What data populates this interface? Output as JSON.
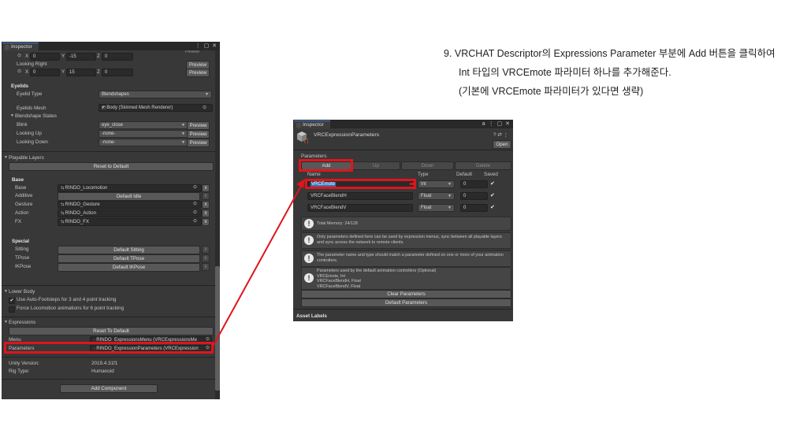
{
  "left": {
    "tab": "Inspector",
    "window_controls": "⋮ ▢ ✕",
    "top_cut_label": "Preview",
    "rows": {
      "eye_left": {
        "x_label": "X",
        "x_value": "0",
        "y_label": "Y",
        "y_value": "-15",
        "z_label": "Z",
        "z_value": "0",
        "preview": "Preview"
      },
      "looking_right": "Looking Right",
      "eye_right": {
        "x_label": "X",
        "x_value": "0",
        "y_label": "Y",
        "y_value": "15",
        "z_label": "Z",
        "z_value": "0",
        "preview": "Preview"
      }
    },
    "eyelids": {
      "title": "Eyelids",
      "type_label": "Eyelid Type",
      "type_value": "Blendshapes",
      "mesh_label": "Eyelids Mesh",
      "mesh_value": "Body (Skinned Mesh Renderer)",
      "states_label": "Blendshape States",
      "states": [
        {
          "label": "Blink",
          "value": "eye_close",
          "preview": "Preview"
        },
        {
          "label": "Looking Up",
          "value": "-none-",
          "preview": "Preview"
        },
        {
          "label": "Looking Down",
          "value": "-none-",
          "preview": "Preview"
        }
      ]
    },
    "playable": {
      "title": "Playable Layers",
      "reset": "Reset to Default",
      "base_title": "Base",
      "base": [
        {
          "label": "Base",
          "value": "RINDO_Locomotion",
          "x": "x"
        },
        {
          "label": "Additive",
          "value": "Default Idle",
          "x": "x"
        },
        {
          "label": "Gesture",
          "value": "RINDO_Gesture",
          "x": "x"
        },
        {
          "label": "Action",
          "value": "RINDO_Action",
          "x": "x"
        },
        {
          "label": "FX",
          "value": "RINDO_FX",
          "x": "x"
        }
      ],
      "special_title": "Special",
      "special": [
        {
          "label": "Sitting",
          "value": "Default Sitting",
          "x": "x"
        },
        {
          "label": "TPose",
          "value": "Default TPose",
          "x": "x"
        },
        {
          "label": "IKPose",
          "value": "Default IKPose",
          "x": "x"
        }
      ]
    },
    "lower_body": {
      "title": "Lower Body",
      "auto_footsteps": "Use Auto-Footsteps for 3 and 4 point tracking",
      "force_loco": "Force Locomotion animations for 6 point tracking"
    },
    "expressions": {
      "title": "Expressions",
      "reset": "Reset To Default",
      "menu_label": "Menu",
      "menu_value": "RINDO_ExpressionsMenu (VRCExpressionsMe",
      "params_label": "Parameters",
      "params_value": "RINDO_ExpressionParameters (VRCExpression"
    },
    "unity_label": "Unity Version:",
    "unity_value": "2019.4.31f1",
    "rig_label": "Rig Type:",
    "rig_value": "Humanoid",
    "add_component": "Add Component"
  },
  "right": {
    "tab": "Inspector",
    "window_controls": "a ⋮ ▢ ✕",
    "asset_name": "VRCExpressionParameters",
    "header_icons": "? ⇄ ⋮",
    "open": "Open",
    "params_label": "Parameters",
    "buttons": {
      "add": "Add",
      "up": "Up",
      "down": "Down",
      "delete": "Delete"
    },
    "columns": {
      "name": "Name",
      "type": "Type",
      "default": "Default",
      "saved": "Saved"
    },
    "params": [
      {
        "name": "VRCEmote",
        "type": "Int",
        "default": "0",
        "saved": "✔"
      },
      {
        "name": "VRCFaceBlendH",
        "type": "Float",
        "default": "0",
        "saved": "✔"
      },
      {
        "name": "VRCFaceBlendV",
        "type": "Float",
        "default": "0",
        "saved": "✔"
      }
    ],
    "total_memory": "Total Memory: 24/128",
    "help1": "Only parameters defined here can be used by expression menus, sync between all playable layers and sync across the network to remote clients.",
    "help2": "The parameter name and type should match a parameter defined on one or more of your animation controllers.",
    "help3_lines": [
      "Parameters used by the default animation controllers (Optional)",
      "VRCEmote, Int",
      "VRCFaceBlendH, Float",
      "VRCFaceBlendV, Float"
    ],
    "clear": "Clear Parameters",
    "default_params": "Default Parameters",
    "asset_labels": "Asset Labels"
  },
  "instructions": {
    "line1": "9. VRCHAT Descriptor의 Expressions Parameter 부분에 Add 버튼을 클릭하여",
    "line2": "Int 타입의 VRCEmote 파라미터 하나를 추가해준다.",
    "line3": "(기본에 VRCEmote 파라미터가 있다면 생략)"
  },
  "colors": {
    "highlight": "#e0141c",
    "panel": "#383838",
    "selection": "#3a72b0"
  }
}
